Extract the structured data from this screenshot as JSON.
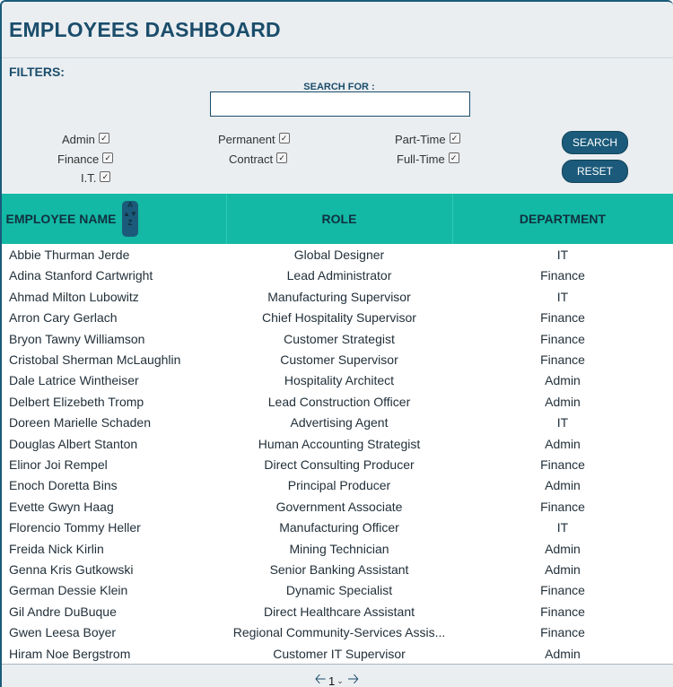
{
  "header": {
    "title": "EMPLOYEES DASHBOARD"
  },
  "filters": {
    "label": "FILTERS:",
    "search_label": "SEARCH FOR :",
    "search_value": "",
    "departments": [
      {
        "label": "Admin",
        "checked": true
      },
      {
        "label": "Finance",
        "checked": true
      },
      {
        "label": "I.T.",
        "checked": true
      }
    ],
    "contracts": [
      {
        "label": "Permanent",
        "checked": true
      },
      {
        "label": "Contract",
        "checked": true
      }
    ],
    "schedules": [
      {
        "label": "Part-Time",
        "checked": true
      },
      {
        "label": "Full-Time",
        "checked": true
      }
    ],
    "search_button": "SEARCH",
    "reset_button": "RESET"
  },
  "table": {
    "headers": [
      "EMPLOYEE NAME",
      "ROLE",
      "DEPARTMENT"
    ],
    "sort_glyphs": [
      "A",
      "Z"
    ],
    "rows": [
      [
        "Abbie Thurman Jerde",
        "Global Designer",
        "IT"
      ],
      [
        "Adina Stanford Cartwright",
        "Lead Administrator",
        "Finance"
      ],
      [
        "Ahmad Milton Lubowitz",
        "Manufacturing Supervisor",
        "IT"
      ],
      [
        "Arron Cary Gerlach",
        "Chief Hospitality Supervisor",
        "Finance"
      ],
      [
        "Bryon Tawny Williamson",
        "Customer Strategist",
        "Finance"
      ],
      [
        "Cristobal Sherman McLaughlin",
        "Customer Supervisor",
        "Finance"
      ],
      [
        "Dale Latrice Wintheiser",
        "Hospitality Architect",
        "Admin"
      ],
      [
        "Delbert Elizebeth Tromp",
        "Lead Construction Officer",
        "Admin"
      ],
      [
        "Doreen Marielle Schaden",
        "Advertising Agent",
        "IT"
      ],
      [
        "Douglas Albert Stanton",
        "Human Accounting Strategist",
        "Admin"
      ],
      [
        "Elinor Joi Rempel",
        "Direct Consulting Producer",
        "Finance"
      ],
      [
        "Enoch Doretta Bins",
        "Principal Producer",
        "Admin"
      ],
      [
        "Evette Gwyn Haag",
        "Government Associate",
        "Finance"
      ],
      [
        "Florencio Tommy Heller",
        "Manufacturing Officer",
        "IT"
      ],
      [
        "Freida Nick Kirlin",
        "Mining Technician",
        "Admin"
      ],
      [
        "Genna Kris Gutkowski",
        "Senior Banking Assistant",
        "Admin"
      ],
      [
        "German Dessie Klein",
        "Dynamic Specialist",
        "Finance"
      ],
      [
        "Gil Andre DuBuque",
        "Direct Healthcare Assistant",
        "Finance"
      ],
      [
        "Gwen Leesa Boyer",
        "Regional Community-Services Assis...",
        "Finance"
      ],
      [
        "Hiram Noe Bergstrom",
        "Customer IT Supervisor",
        "Admin"
      ]
    ]
  },
  "pagination": {
    "current_page": "1",
    "prev_icon": "arrow-left-icon",
    "next_icon": "arrow-right-icon"
  },
  "colors": {
    "accent": "#1b5a7a",
    "table_header": "#13b9a5",
    "title": "#1b4d6b"
  }
}
